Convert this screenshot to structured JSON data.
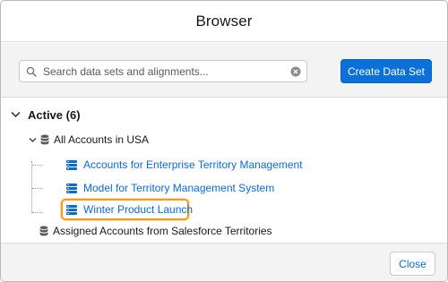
{
  "dialog": {
    "title": "Browser"
  },
  "toolbar": {
    "search_placeholder": "Search data sets and alignments...",
    "search_value": "",
    "create_button_label": "Create Data Set"
  },
  "tree": {
    "group": {
      "label": "Active (6)",
      "expanded": true
    },
    "parent_item": {
      "label": "All Accounts in USA",
      "expanded": true
    },
    "children": [
      {
        "label": "Accounts for Enterprise Territory Management"
      },
      {
        "label": "Model for Territory Management System"
      },
      {
        "label": "Winter Product Launch",
        "highlighted": true
      }
    ],
    "sibling_item": {
      "label": "Assigned Accounts from Salesforce Territories"
    }
  },
  "footer": {
    "close_label": "Close"
  },
  "colors": {
    "primary": "#0b70d8",
    "link": "#0b6ad1",
    "highlight": "#f39a1d"
  }
}
